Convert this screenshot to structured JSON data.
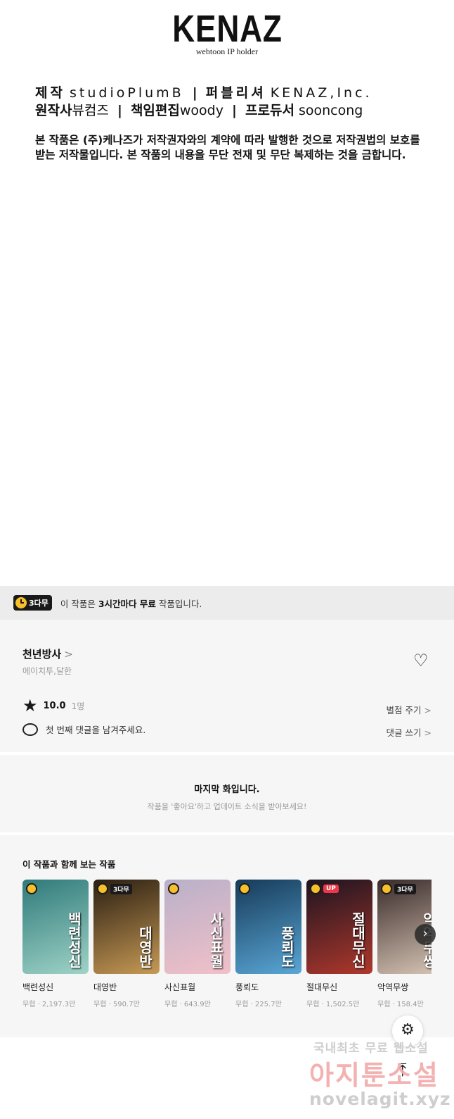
{
  "credits": {
    "logo": "KENAZ",
    "logo_sub": "webtoon IP holder",
    "line1": {
      "label_a": "제작",
      "value_a": "studioPlumB",
      "label_b": "퍼블리셔",
      "value_b": "KENAZ,Inc."
    },
    "line2": {
      "label_a": "원작사",
      "value_a": "뷰컴즈",
      "label_b": "책임편집",
      "value_b": "woody",
      "label_c": "프로듀서",
      "value_c": "sooncong"
    },
    "separator": "|",
    "notice": "본 작품은 (주)케나즈가 저작권자와의 계약에 따라 발행한 것으로 저작권법의 보호를 받는 저작물입니다. 본 작품의 내용을 무단 전재 및 무단 복제하는 것을 금합니다."
  },
  "free_banner": {
    "badge": "3다무",
    "text_prefix": "이 작품은 ",
    "text_bold": "3시간마다 무료",
    "text_suffix": " 작품입니다."
  },
  "work": {
    "title": "천년방사",
    "chevron": ">",
    "authors": "에이치투,달한",
    "heart_icon": "heart-outline",
    "score": "10.0",
    "rating_count": "1명",
    "rate_action": "별점 주기",
    "comment_prompt": "첫 번째 댓글을 남겨주세요.",
    "comment_action": "댓글 쓰기"
  },
  "last_chapter": {
    "title": "마지막 화입니다.",
    "subtitle": "작품을 '좋아요'하고 업데이트 소식을 받아보세요!"
  },
  "recommendations": {
    "title": "이 작품과 함께 보는 작품",
    "items": [
      {
        "name": "백련성신",
        "meta": "무협 · 2,197.3만",
        "cover_text": "백련성신",
        "tag": "",
        "colors": [
          "#2f7a7a",
          "#9fd3c7"
        ]
      },
      {
        "name": "대영반",
        "meta": "무협 · 590.7만",
        "cover_text": "대영반",
        "tag": "3다무",
        "colors": [
          "#2a1e12",
          "#c79a55"
        ]
      },
      {
        "name": "사신표월",
        "meta": "무협 · 643.9만",
        "cover_text": "사신표월",
        "tag": "",
        "colors": [
          "#b9b0c9",
          "#f1c0c8"
        ]
      },
      {
        "name": "풍뢰도",
        "meta": "무협 · 225.7만",
        "cover_text": "풍뢰도",
        "tag": "",
        "colors": [
          "#163a58",
          "#5aa7d6"
        ]
      },
      {
        "name": "절대무신",
        "meta": "무협 · 1,502.5만",
        "cover_text": "절대무신",
        "tag": "UP",
        "colors": [
          "#1b1420",
          "#b0382c"
        ]
      },
      {
        "name": "악역무쌍",
        "meta": "무협 · 158.4만",
        "cover_text": "악역무쌍",
        "tag": "3다무",
        "colors": [
          "#3a2a2a",
          "#d8c7b6"
        ]
      }
    ],
    "next_icon": "chevron-right"
  },
  "floating": {
    "settings_icon": "gear",
    "top_icon": "arrow-up"
  },
  "watermark": {
    "line1": "국내최초 무료 웹소설",
    "line2": "아지툰소설",
    "line3": "novelagit.xyz"
  }
}
